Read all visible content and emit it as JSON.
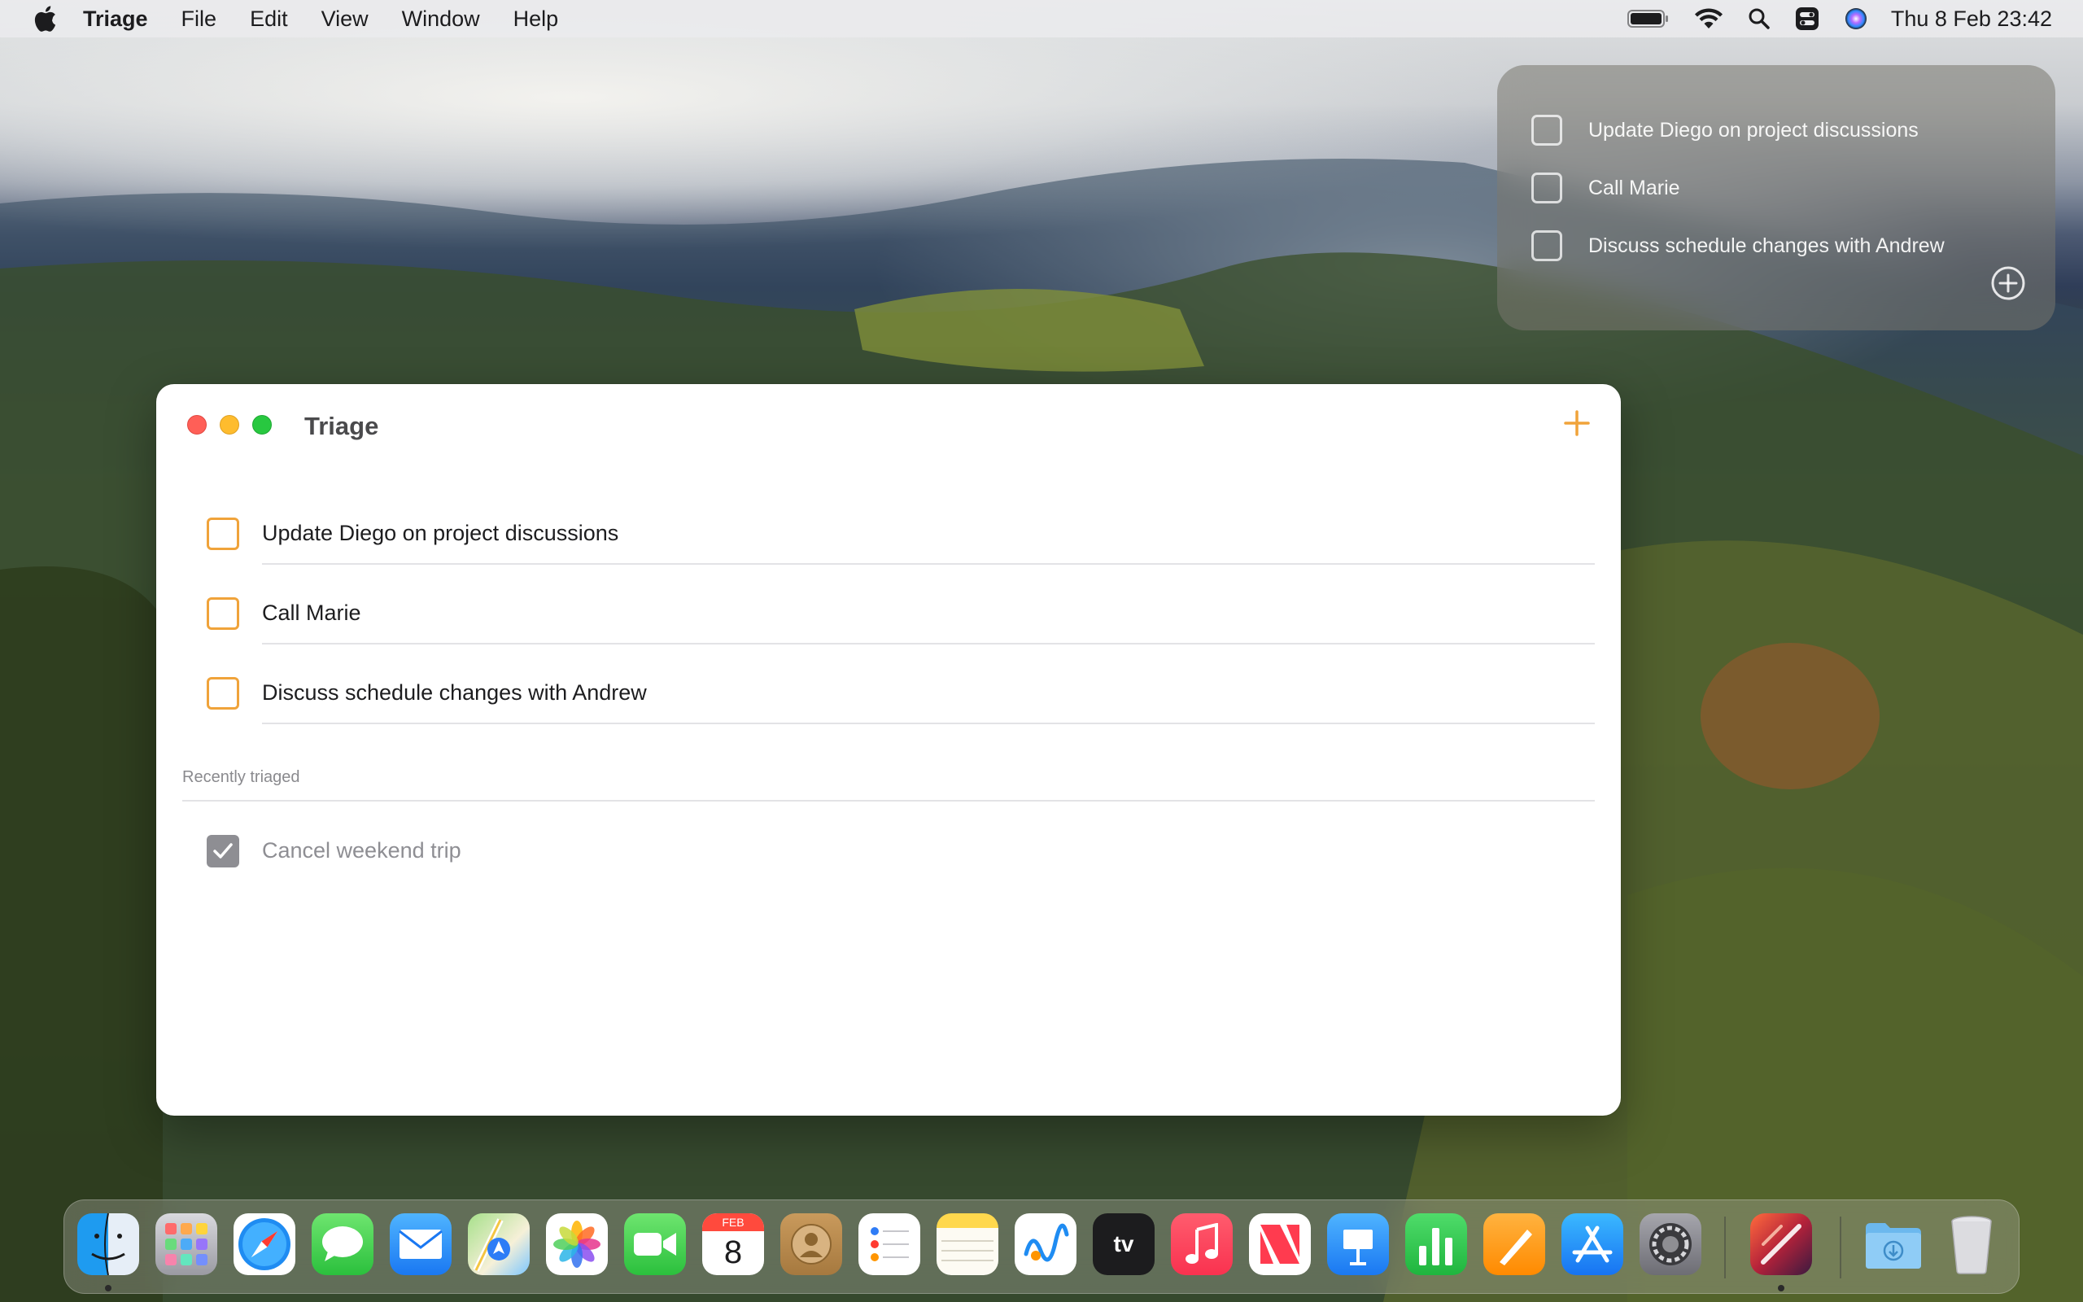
{
  "menubar": {
    "app_name": "Triage",
    "menus": [
      "File",
      "Edit",
      "View",
      "Window",
      "Help"
    ],
    "clock": "Thu 8 Feb  23:42"
  },
  "widget": {
    "items": [
      {
        "label": "Update Diego on project discussions"
      },
      {
        "label": "Call Marie"
      },
      {
        "label": "Discuss schedule changes with Andrew"
      }
    ]
  },
  "window": {
    "title": "Triage",
    "tasks": [
      {
        "label": "Update Diego on project discussions",
        "checked": false
      },
      {
        "label": "Call Marie",
        "checked": false
      },
      {
        "label": "Discuss schedule changes with Andrew",
        "checked": false
      }
    ],
    "recent_section_label": "Recently triaged",
    "recent": [
      {
        "label": "Cancel weekend trip",
        "checked": true
      }
    ]
  },
  "dock": {
    "calendar_month": "FEB",
    "calendar_day": "8",
    "apps": [
      "finder-icon",
      "launchpad-icon",
      "safari-icon",
      "messages-icon",
      "mail-icon",
      "maps-icon",
      "photos-icon",
      "facetime-icon",
      "calendar-icon",
      "contacts-icon",
      "reminders-icon",
      "notes-icon",
      "freeform-icon",
      "apple-tv-icon",
      "music-icon",
      "news-icon",
      "keynote-icon",
      "numbers-icon",
      "pages-icon",
      "app-store-icon",
      "system-settings-icon",
      "triage-app-icon",
      "downloads-folder-icon",
      "trash-icon"
    ]
  },
  "colors": {
    "accent": "#f0a33a",
    "checked": "#8e8e93"
  }
}
